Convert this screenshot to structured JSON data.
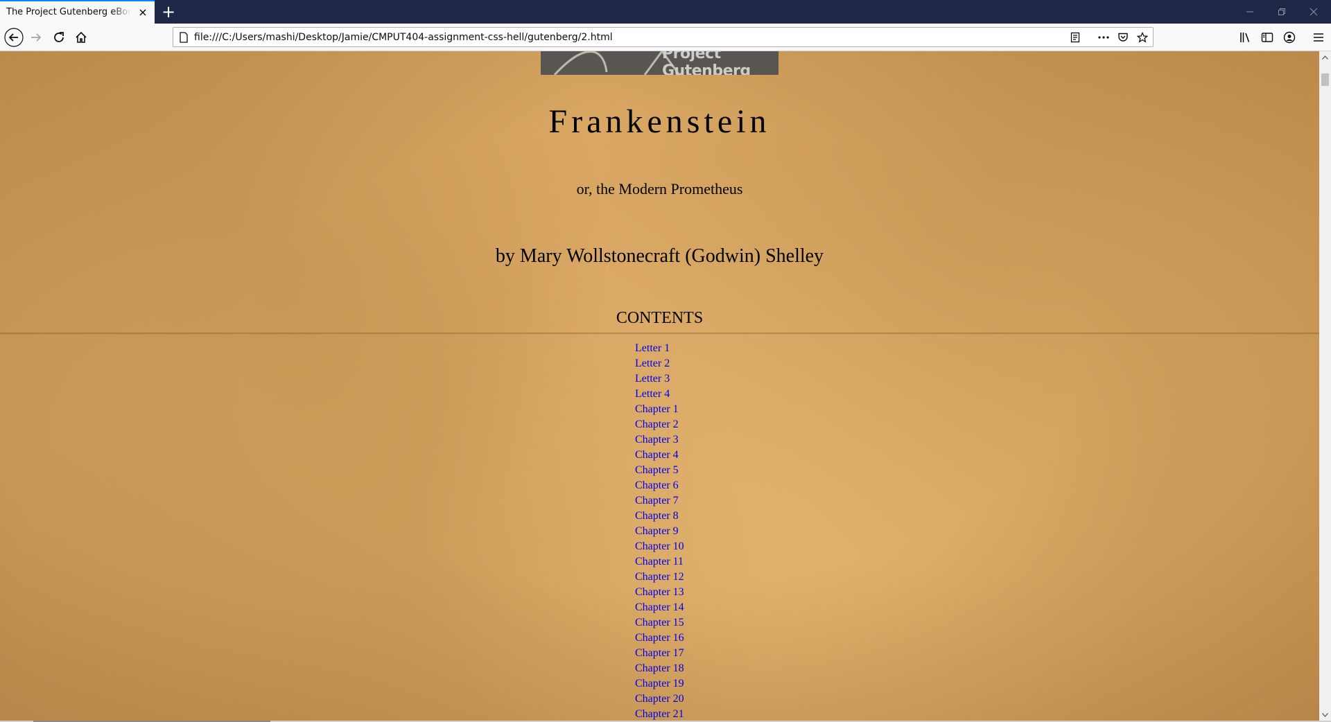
{
  "browser": {
    "tab_title": "The Project Gutenberg eBook of Frankenstein",
    "new_tab_label": "+",
    "url": "file:///C:/Users/mashi/Desktop/Jamie/CMPUT404-assignment-css-hell/gutenberg/2.html",
    "icons": [
      "back-arrow-icon",
      "forward-arrow-icon",
      "reload-icon",
      "home-icon",
      "page-icon",
      "reader-view-icon",
      "more-actions-icon",
      "pocket-icon",
      "bookmark-star-icon",
      "library-icon",
      "sidebar-icon",
      "account-icon",
      "menu-icon",
      "minimize-icon",
      "restore-icon",
      "close-icon"
    ]
  },
  "page": {
    "banner_text": "Project Gutenberg",
    "title": "Frankenstein",
    "subtitle": "or, the Modern Prometheus",
    "author": "by Mary Wollstonecraft (Godwin) Shelley",
    "contents_heading": "CONTENTS",
    "toc": [
      "Letter 1",
      "Letter 2",
      "Letter 3",
      "Letter 4",
      "Chapter 1",
      "Chapter 2",
      "Chapter 3",
      "Chapter 4",
      "Chapter 5",
      "Chapter 6",
      "Chapter 7",
      "Chapter 8",
      "Chapter 9",
      "Chapter 10",
      "Chapter 11",
      "Chapter 12",
      "Chapter 13",
      "Chapter 14",
      "Chapter 15",
      "Chapter 16",
      "Chapter 17",
      "Chapter 18",
      "Chapter 19",
      "Chapter 20",
      "Chapter 21"
    ]
  },
  "colors": {
    "link": "#0000ee",
    "parchment": "#d9a763",
    "tabstrip": "#1f2947",
    "tab_accent": "#0a84ff"
  }
}
